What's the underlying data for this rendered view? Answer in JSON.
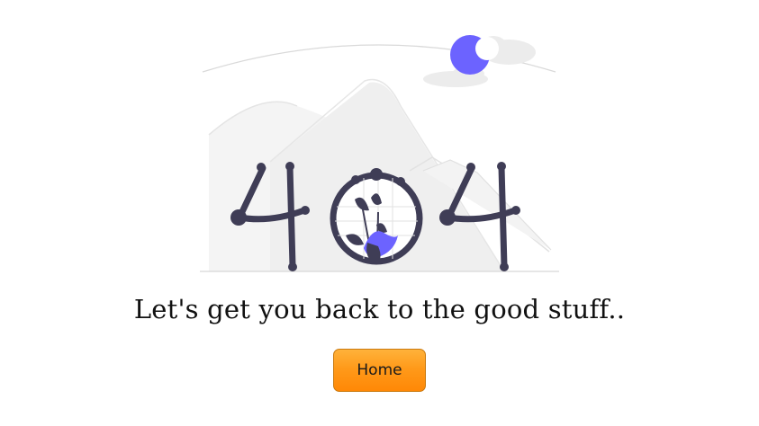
{
  "error_code_digits": [
    "4",
    "0",
    "4"
  ],
  "message": "Let's get you back to the good stuff..",
  "home_button": {
    "label": "Home"
  },
  "colors": {
    "accent_purple": "#6c63ff",
    "figure_dark": "#3f3d56",
    "mountain_gray": "#f0f0f0",
    "line_gray": "#d6d6d6",
    "button_orange": "#ff9a1a"
  }
}
